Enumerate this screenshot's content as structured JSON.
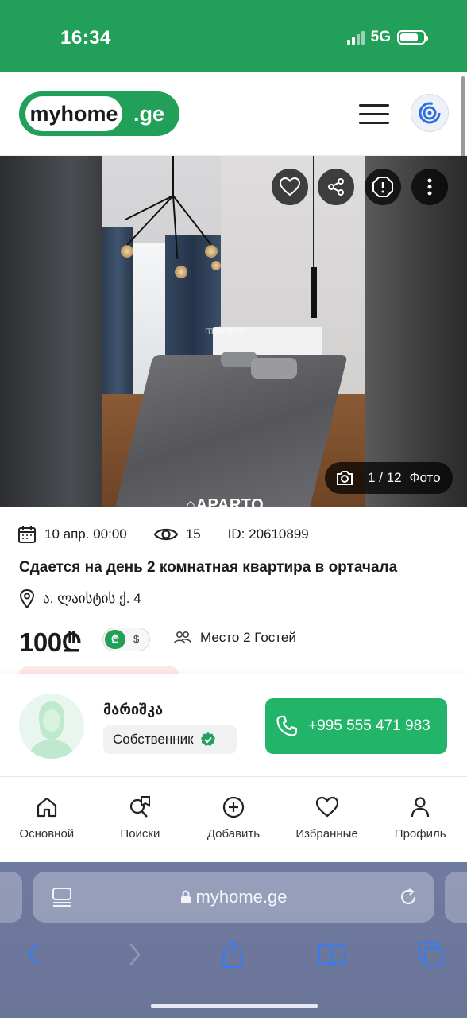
{
  "status_bar": {
    "time": "16:34",
    "network": "5G",
    "battery_level": 0.8
  },
  "header": {
    "logo_main": "myhome",
    "logo_suffix": ".ge"
  },
  "photo": {
    "counter": "1 / 12",
    "counter_label": "Фото",
    "watermark": "APARTO",
    "overlay_watermark": "myhome"
  },
  "listing": {
    "date": "10 апр. 00:00",
    "views": "15",
    "id": "ID: 20610899",
    "title": "Сдается на день 2 комнатная квартира в ортачала",
    "address": "ა. ლაისტის ქ. 4",
    "price": "100₾",
    "currency_gel": "₾",
    "currency_usd": "$",
    "guests": "Место 2 Гостей"
  },
  "owner": {
    "name": "მარიშკა",
    "role": "Собственник",
    "phone": "+995 555 471 983"
  },
  "bottom_nav": [
    {
      "label": "Основной",
      "icon": "home-icon"
    },
    {
      "label": "Поиски",
      "icon": "search-bookmark-icon"
    },
    {
      "label": "Добавить",
      "icon": "add-circle-icon"
    },
    {
      "label": "Избранные",
      "icon": "heart-icon"
    },
    {
      "label": "Профиль",
      "icon": "user-icon"
    }
  ],
  "browser": {
    "url": "myhome.ge"
  },
  "colors": {
    "brand": "#22a05a",
    "call_button": "#22b469"
  }
}
